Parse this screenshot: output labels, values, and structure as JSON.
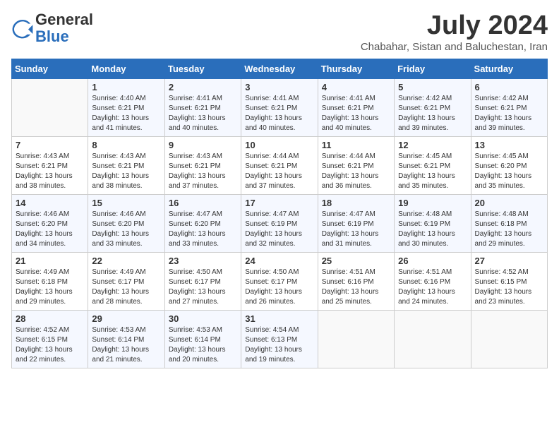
{
  "header": {
    "logo": {
      "line1": "General",
      "line2": "Blue"
    },
    "title": "July 2024",
    "location": "Chabahar, Sistan and Baluchestan, Iran"
  },
  "calendar": {
    "days_of_week": [
      "Sunday",
      "Monday",
      "Tuesday",
      "Wednesday",
      "Thursday",
      "Friday",
      "Saturday"
    ],
    "weeks": [
      [
        {
          "day": "",
          "info": ""
        },
        {
          "day": "1",
          "info": "Sunrise: 4:40 AM\nSunset: 6:21 PM\nDaylight: 13 hours\nand 41 minutes."
        },
        {
          "day": "2",
          "info": "Sunrise: 4:41 AM\nSunset: 6:21 PM\nDaylight: 13 hours\nand 40 minutes."
        },
        {
          "day": "3",
          "info": "Sunrise: 4:41 AM\nSunset: 6:21 PM\nDaylight: 13 hours\nand 40 minutes."
        },
        {
          "day": "4",
          "info": "Sunrise: 4:41 AM\nSunset: 6:21 PM\nDaylight: 13 hours\nand 40 minutes."
        },
        {
          "day": "5",
          "info": "Sunrise: 4:42 AM\nSunset: 6:21 PM\nDaylight: 13 hours\nand 39 minutes."
        },
        {
          "day": "6",
          "info": "Sunrise: 4:42 AM\nSunset: 6:21 PM\nDaylight: 13 hours\nand 39 minutes."
        }
      ],
      [
        {
          "day": "7",
          "info": "Sunrise: 4:43 AM\nSunset: 6:21 PM\nDaylight: 13 hours\nand 38 minutes."
        },
        {
          "day": "8",
          "info": "Sunrise: 4:43 AM\nSunset: 6:21 PM\nDaylight: 13 hours\nand 38 minutes."
        },
        {
          "day": "9",
          "info": "Sunrise: 4:43 AM\nSunset: 6:21 PM\nDaylight: 13 hours\nand 37 minutes."
        },
        {
          "day": "10",
          "info": "Sunrise: 4:44 AM\nSunset: 6:21 PM\nDaylight: 13 hours\nand 37 minutes."
        },
        {
          "day": "11",
          "info": "Sunrise: 4:44 AM\nSunset: 6:21 PM\nDaylight: 13 hours\nand 36 minutes."
        },
        {
          "day": "12",
          "info": "Sunrise: 4:45 AM\nSunset: 6:21 PM\nDaylight: 13 hours\nand 35 minutes."
        },
        {
          "day": "13",
          "info": "Sunrise: 4:45 AM\nSunset: 6:20 PM\nDaylight: 13 hours\nand 35 minutes."
        }
      ],
      [
        {
          "day": "14",
          "info": "Sunrise: 4:46 AM\nSunset: 6:20 PM\nDaylight: 13 hours\nand 34 minutes."
        },
        {
          "day": "15",
          "info": "Sunrise: 4:46 AM\nSunset: 6:20 PM\nDaylight: 13 hours\nand 33 minutes."
        },
        {
          "day": "16",
          "info": "Sunrise: 4:47 AM\nSunset: 6:20 PM\nDaylight: 13 hours\nand 33 minutes."
        },
        {
          "day": "17",
          "info": "Sunrise: 4:47 AM\nSunset: 6:19 PM\nDaylight: 13 hours\nand 32 minutes."
        },
        {
          "day": "18",
          "info": "Sunrise: 4:47 AM\nSunset: 6:19 PM\nDaylight: 13 hours\nand 31 minutes."
        },
        {
          "day": "19",
          "info": "Sunrise: 4:48 AM\nSunset: 6:19 PM\nDaylight: 13 hours\nand 30 minutes."
        },
        {
          "day": "20",
          "info": "Sunrise: 4:48 AM\nSunset: 6:18 PM\nDaylight: 13 hours\nand 29 minutes."
        }
      ],
      [
        {
          "day": "21",
          "info": "Sunrise: 4:49 AM\nSunset: 6:18 PM\nDaylight: 13 hours\nand 29 minutes."
        },
        {
          "day": "22",
          "info": "Sunrise: 4:49 AM\nSunset: 6:17 PM\nDaylight: 13 hours\nand 28 minutes."
        },
        {
          "day": "23",
          "info": "Sunrise: 4:50 AM\nSunset: 6:17 PM\nDaylight: 13 hours\nand 27 minutes."
        },
        {
          "day": "24",
          "info": "Sunrise: 4:50 AM\nSunset: 6:17 PM\nDaylight: 13 hours\nand 26 minutes."
        },
        {
          "day": "25",
          "info": "Sunrise: 4:51 AM\nSunset: 6:16 PM\nDaylight: 13 hours\nand 25 minutes."
        },
        {
          "day": "26",
          "info": "Sunrise: 4:51 AM\nSunset: 6:16 PM\nDaylight: 13 hours\nand 24 minutes."
        },
        {
          "day": "27",
          "info": "Sunrise: 4:52 AM\nSunset: 6:15 PM\nDaylight: 13 hours\nand 23 minutes."
        }
      ],
      [
        {
          "day": "28",
          "info": "Sunrise: 4:52 AM\nSunset: 6:15 PM\nDaylight: 13 hours\nand 22 minutes."
        },
        {
          "day": "29",
          "info": "Sunrise: 4:53 AM\nSunset: 6:14 PM\nDaylight: 13 hours\nand 21 minutes."
        },
        {
          "day": "30",
          "info": "Sunrise: 4:53 AM\nSunset: 6:14 PM\nDaylight: 13 hours\nand 20 minutes."
        },
        {
          "day": "31",
          "info": "Sunrise: 4:54 AM\nSunset: 6:13 PM\nDaylight: 13 hours\nand 19 minutes."
        },
        {
          "day": "",
          "info": ""
        },
        {
          "day": "",
          "info": ""
        },
        {
          "day": "",
          "info": ""
        }
      ]
    ]
  }
}
